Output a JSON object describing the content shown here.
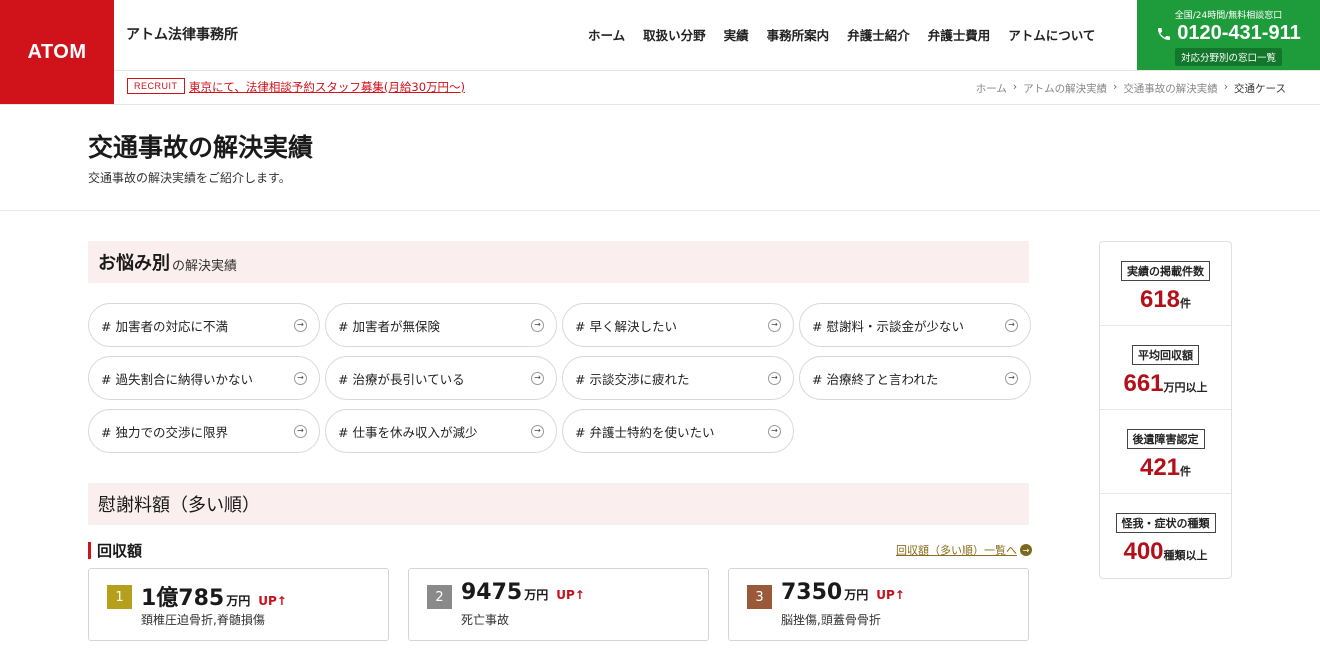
{
  "header": {
    "logo": "ATOM",
    "firm_name": "アトム法律事務所",
    "nav": [
      "ホーム",
      "取扱い分野",
      "実績",
      "事務所案内",
      "弁護士紹介",
      "弁護士費用",
      "アトムについて"
    ],
    "cta": {
      "sub": "全国/24時間/無料相談窓口",
      "phone": "0120-431-911",
      "button": "対応分野別の窓口一覧"
    },
    "recruit_badge": "RECRUIT",
    "recruit_link": "東京にて、法律相談予約スタッフ募集(月給30万円〜)"
  },
  "breadcrumb": [
    "ホーム",
    "アトムの解決実績",
    "交通事故の解決実績",
    "交通ケース"
  ],
  "page": {
    "title": "交通事故の解決実績",
    "description": "交通事故の解決実績をご紹介します。"
  },
  "worries": {
    "heading_big": "お悩み別",
    "heading_small": "の解決実績",
    "tags": [
      "# 加害者の対応に不満",
      "# 加害者が無保険",
      "# 早く解決したい",
      "# 慰謝料・示談金が少ない",
      "# 過失割合に納得いかない",
      "# 治療が長引いている",
      "# 示談交渉に疲れた",
      "# 治療終了と言われた",
      "# 独力での交渉に限界",
      "# 仕事を休み収入が減少",
      "# 弁護士特約を使いたい"
    ]
  },
  "ranking": {
    "heading": "慰謝料額（多い順）",
    "sub_heading": "回収額",
    "more_link": "回収額（多い順）一覧へ",
    "cards": [
      {
        "rank": "1",
        "color": "#b5a01b",
        "amount": "1億785",
        "unit": "万円",
        "up": "UP",
        "cases": "頚椎圧迫骨折,脊髄損傷"
      },
      {
        "rank": "2",
        "color": "#8a8a8a",
        "amount": "9475",
        "unit": "万円",
        "up": "UP",
        "cases": "死亡事故"
      },
      {
        "rank": "3",
        "color": "#9a5a3a",
        "amount": "7350",
        "unit": "万円",
        "up": "UP",
        "cases": "脳挫傷,頭蓋骨骨折"
      }
    ]
  },
  "stats": [
    {
      "label": "実績の掲載件数",
      "value": "618",
      "unit": "件"
    },
    {
      "label": "平均回収額",
      "value": "661",
      "unit": "万円以上"
    },
    {
      "label": "後遺障害認定",
      "value": "421",
      "unit": "件"
    },
    {
      "label": "怪我・症状の種類",
      "value": "400",
      "unit": "種類以上"
    }
  ],
  "colors": {
    "brand_red": "#d0121b",
    "cta_green": "#1e9b3b",
    "section_bg": "#fbeeee"
  }
}
